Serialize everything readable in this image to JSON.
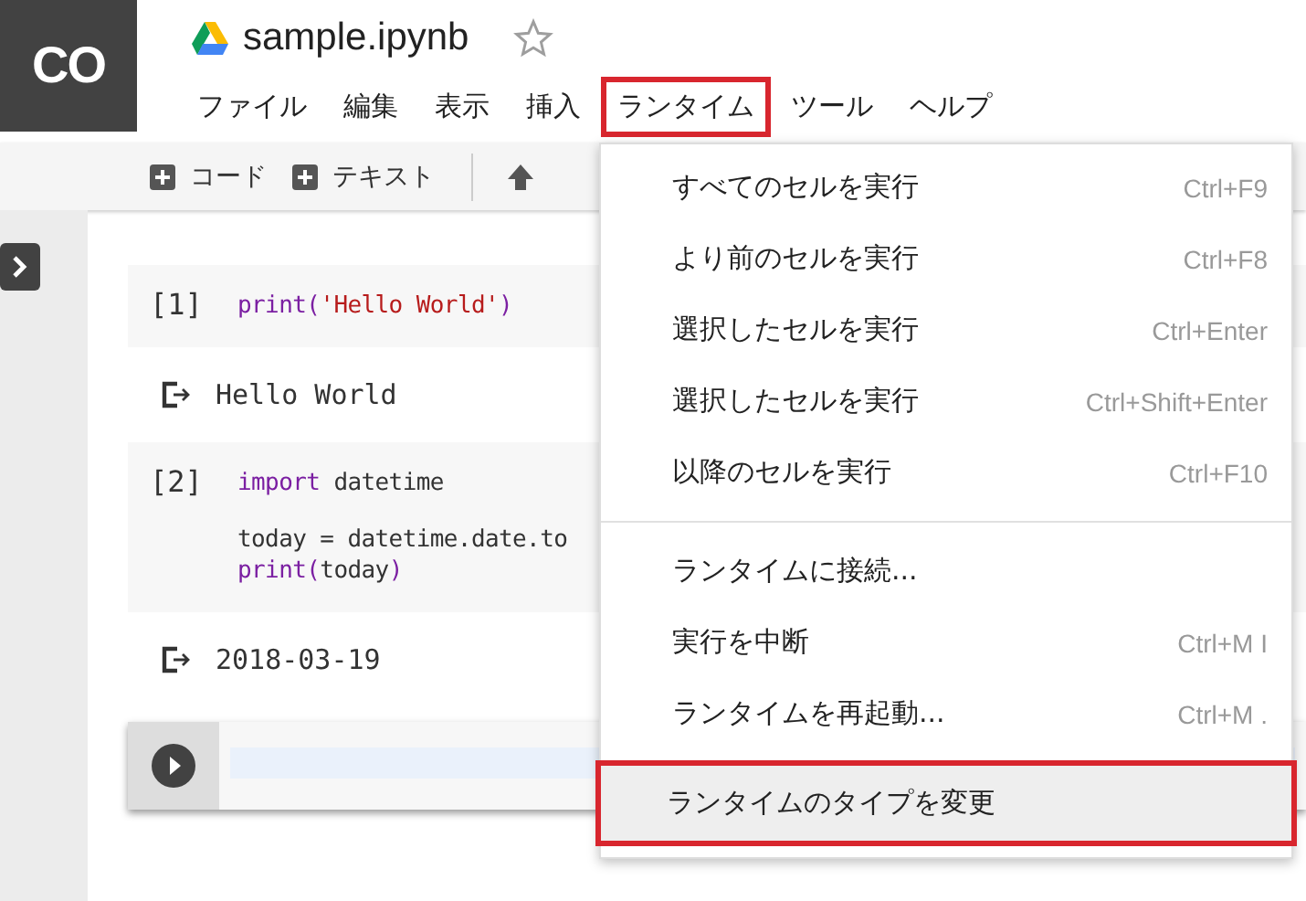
{
  "app": {
    "logo": "CO",
    "title": "sample.ipynb",
    "starred": false
  },
  "menubar": [
    {
      "label": "ファイル",
      "selected": false
    },
    {
      "label": "編集",
      "selected": false
    },
    {
      "label": "表示",
      "selected": false
    },
    {
      "label": "挿入",
      "selected": false
    },
    {
      "label": "ランタイム",
      "selected": true
    },
    {
      "label": "ツール",
      "selected": false
    },
    {
      "label": "ヘルプ",
      "selected": false
    }
  ],
  "toolbar": [
    {
      "label": "コード"
    },
    {
      "label": "テキスト"
    }
  ],
  "cells": [
    {
      "kind": "code",
      "prompt": "[1]",
      "paragraphs": [
        {
          "lines": [
            {
              "tokens": [
                {
                  "color": "#7b1fa2",
                  "t": "print("
                },
                {
                  "color": "#b71c1c",
                  "t": "'Hello World'"
                },
                {
                  "color": "#7b1fa2",
                  "t": ")"
                }
              ]
            }
          ]
        }
      ]
    },
    {
      "kind": "output",
      "text": "Hello World"
    },
    {
      "kind": "code",
      "prompt": "[2]",
      "paragraphs": [
        {
          "lines": [
            {
              "tokens": [
                {
                  "color": "#7b1fa2",
                  "t": "import"
                },
                {
                  "color": "#333333",
                  "t": " datetime"
                }
              ]
            }
          ]
        },
        {
          "lines": [
            {
              "tokens": [
                {
                  "color": "#333333",
                  "t": "today = datetime.date.to"
                }
              ]
            },
            {
              "tokens": [
                {
                  "color": "#7b1fa2",
                  "t": "print("
                },
                {
                  "color": "#333333",
                  "t": "today"
                },
                {
                  "color": "#7b1fa2",
                  "t": ")"
                }
              ]
            }
          ]
        }
      ]
    },
    {
      "kind": "output",
      "text": "2018-03-19"
    },
    {
      "kind": "empty"
    }
  ],
  "menu": [
    {
      "kind": "item",
      "label": "すべてのセルを実行",
      "shortcut": "Ctrl+F9",
      "selected": false
    },
    {
      "kind": "item",
      "label": "より前のセルを実行",
      "shortcut": "Ctrl+F8",
      "selected": false
    },
    {
      "kind": "item",
      "label": "選択したセルを実行",
      "shortcut": "Ctrl+Enter",
      "selected": false
    },
    {
      "kind": "item",
      "label": "選択したセルを実行",
      "shortcut": "Ctrl+Shift+Enter",
      "selected": false
    },
    {
      "kind": "item",
      "label": "以降のセルを実行",
      "shortcut": "Ctrl+F10",
      "selected": false
    },
    {
      "kind": "separator"
    },
    {
      "kind": "item",
      "label": "ランタイムに接続...",
      "selected": false
    },
    {
      "kind": "item",
      "label": "実行を中断",
      "shortcut": "Ctrl+M I",
      "selected": false
    },
    {
      "kind": "item",
      "label": "ランタイムを再起動...",
      "shortcut": "Ctrl+M .",
      "selected": false
    },
    {
      "kind": "item",
      "label": "ランタイムのタイプを変更",
      "selected": true
    }
  ]
}
